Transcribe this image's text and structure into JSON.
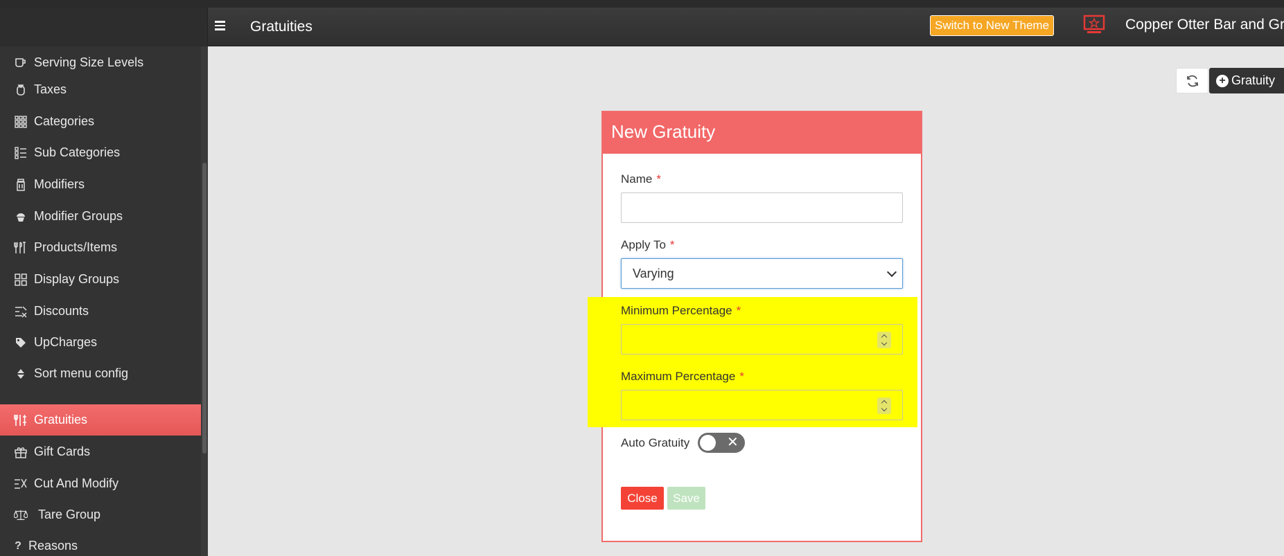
{
  "header": {
    "title": "Gratuities",
    "theme_button": "Switch to New Theme",
    "store_name": "Copper Otter Bar and Grill"
  },
  "sidebar": {
    "items": [
      {
        "label": "Serving Size Levels",
        "icon": "cup-icon"
      },
      {
        "label": "Taxes",
        "icon": "money-bag-icon"
      },
      {
        "label": "Categories",
        "icon": "grid-icon"
      },
      {
        "label": "Sub Categories",
        "icon": "list-icon"
      },
      {
        "label": "Modifiers",
        "icon": "jar-icon"
      },
      {
        "label": "Modifier Groups",
        "icon": "cupcake-icon"
      },
      {
        "label": "Products/Items",
        "icon": "utensils-icon"
      },
      {
        "label": "Display Groups",
        "icon": "squares-icon"
      },
      {
        "label": "Discounts",
        "icon": "discount-icon"
      },
      {
        "label": "UpCharges",
        "icon": "tag-icon"
      },
      {
        "label": "Sort menu config",
        "icon": "sort-icon"
      },
      {
        "label": "Gratuities",
        "icon": "gratuity-icon"
      },
      {
        "label": "Gift Cards",
        "icon": "gift-icon"
      },
      {
        "label": "Cut And Modify",
        "icon": "scissors-icon"
      },
      {
        "label": "Tare Group",
        "icon": "scale-icon"
      },
      {
        "label": "Reasons",
        "icon": "question-icon"
      }
    ],
    "active": "Gratuities"
  },
  "toolbar": {
    "add_label": "Gratuity"
  },
  "modal": {
    "title": "New Gratuity",
    "name_label": "Name",
    "apply_to_label": "Apply To",
    "apply_to_value": "Varying",
    "min_label": "Minimum Percentage",
    "max_label": "Maximum Percentage",
    "auto_label": "Auto Gratuity",
    "required_mark": "*",
    "close_label": "Close",
    "save_label": "Save"
  },
  "colors": {
    "accent": "#f26767",
    "highlight": "#ffff00",
    "theme_button": "#f5a623"
  }
}
